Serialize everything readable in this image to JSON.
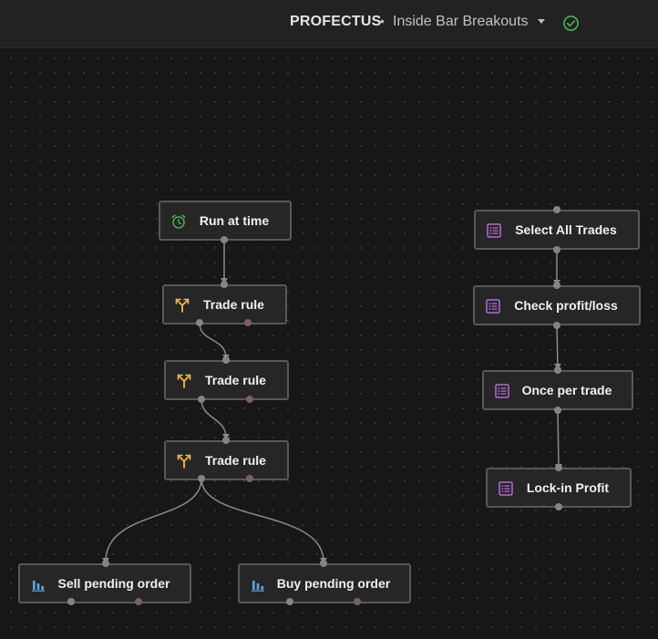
{
  "header": {
    "brand": "PROFECTUS",
    "separator": "•",
    "strategy_name": "Inside Bar Breakouts",
    "status_icon": "check-circle-icon",
    "status_color": "#4caf50"
  },
  "colors": {
    "trigger_icon": "#4caf50",
    "rule_icon": "#f5b841",
    "order_icon": "#5aa7e6",
    "action_icon": "#b46ad6",
    "edge": "#8a8a8a",
    "node_border": "#585858"
  },
  "nodes": {
    "run_at_time": {
      "label": "Run at time",
      "icon": "alarm-clock-icon"
    },
    "trade_rule_1": {
      "label": "Trade rule",
      "icon": "fork-icon"
    },
    "trade_rule_2": {
      "label": "Trade rule",
      "icon": "fork-icon"
    },
    "trade_rule_3": {
      "label": "Trade rule",
      "icon": "fork-icon"
    },
    "sell_pending_order": {
      "label": "Sell pending order",
      "icon": "bar-chart-icon"
    },
    "buy_pending_order": {
      "label": "Buy pending order",
      "icon": "bar-chart-icon"
    },
    "select_all_trades": {
      "label": "Select All Trades",
      "icon": "list-icon"
    },
    "check_profit_loss": {
      "label": "Check profit/loss",
      "icon": "list-icon"
    },
    "once_per_trade": {
      "label": "Once per trade",
      "icon": "list-icon"
    },
    "lock_in_profit": {
      "label": "Lock-in Profit",
      "icon": "list-icon"
    }
  }
}
